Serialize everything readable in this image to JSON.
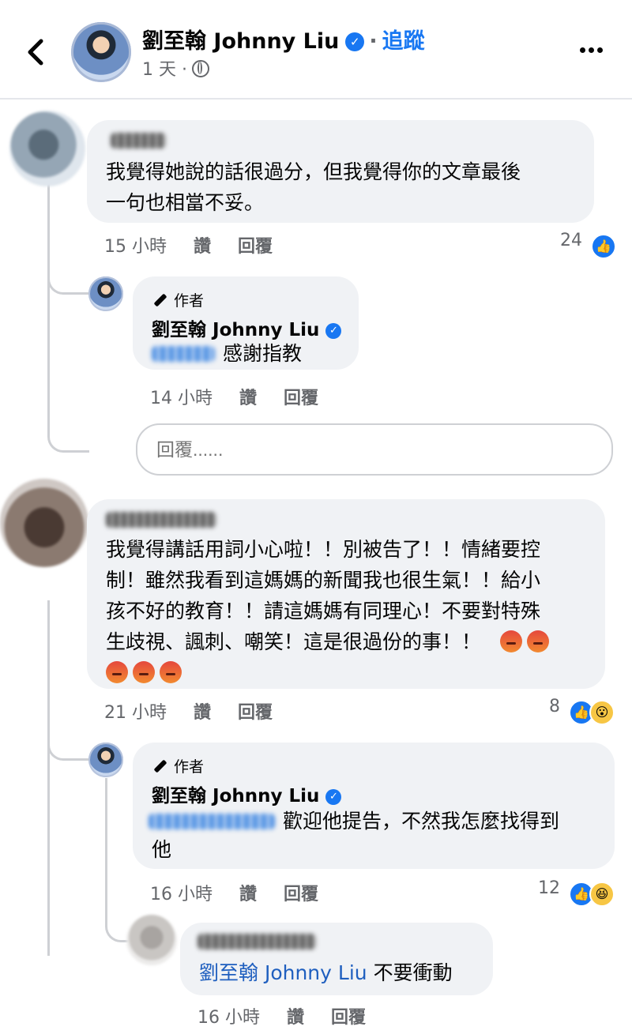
{
  "header": {
    "page_name": "劉至翰 Johnny Liu",
    "follow_label": "追蹤",
    "separator": "·",
    "post_time": "1 天 ·"
  },
  "comments": [
    {
      "text_line1": "我覺得她說的話很過分，但我覺得你的文章最後",
      "text_line2": "一句也相當不妥。",
      "time": "15 小時",
      "like_label": "讚",
      "reply_label": "回覆",
      "reaction_count": "24",
      "reactions": [
        "like"
      ]
    },
    {
      "author_tag": "作者",
      "author_name": "劉至翰 Johnny Liu",
      "text": "感謝指教",
      "time": "14 小時",
      "like_label": "讚",
      "reply_label": "回覆"
    },
    {
      "text_line1": "我覺得講話用詞小心啦！！別被告了！！情緒要控",
      "text_line2": "制！雖然我看到這媽媽的新聞我也很生氣！！給小",
      "text_line3": "孩不好的教育！！請這媽媽有同理心！不要對特殊",
      "text_line4": "生歧視、諷刺、嘲笑！這是很過份的事！！",
      "angry_count": 5,
      "time": "21 小時",
      "like_label": "讚",
      "reply_label": "回覆",
      "reaction_count": "8",
      "reactions": [
        "like",
        "wow"
      ]
    },
    {
      "author_tag": "作者",
      "author_name": "劉至翰 Johnny Liu",
      "text_line1": "歡迎他提告，不然我怎麼找得到",
      "text_line2": "他",
      "time": "16 小時",
      "like_label": "讚",
      "reply_label": "回覆",
      "reaction_count": "12",
      "reactions": [
        "like",
        "haha"
      ]
    },
    {
      "mention": "劉至翰 Johnny Liu",
      "text": "不要衝動",
      "time": "16 小時",
      "like_label": "讚",
      "reply_label": "回覆"
    }
  ],
  "reply_box": {
    "placeholder": "回覆......"
  },
  "colors": {
    "accent": "#1877f2",
    "bubble": "#f0f2f5",
    "meta": "#65676b"
  }
}
